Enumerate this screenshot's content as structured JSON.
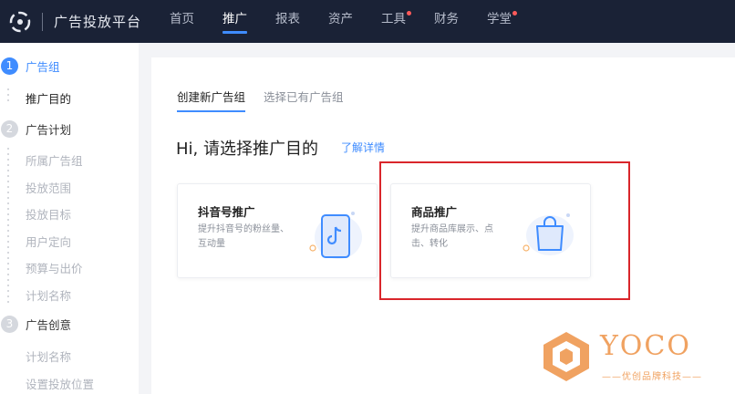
{
  "header": {
    "brand": "广告投放平台",
    "nav": [
      {
        "label": "首页",
        "active": false,
        "dot": false
      },
      {
        "label": "推广",
        "active": true,
        "dot": false
      },
      {
        "label": "报表",
        "active": false,
        "dot": false
      },
      {
        "label": "资产",
        "active": false,
        "dot": false
      },
      {
        "label": "工具",
        "active": false,
        "dot": true
      },
      {
        "label": "财务",
        "active": false,
        "dot": false
      },
      {
        "label": "学堂",
        "active": false,
        "dot": true
      }
    ]
  },
  "sidebar": {
    "steps": [
      {
        "num": "1",
        "title": "广告组",
        "active": true,
        "items": [
          {
            "label": "推广目的",
            "active": true
          }
        ]
      },
      {
        "num": "2",
        "title": "广告计划",
        "active": false,
        "items": [
          {
            "label": "所属广告组"
          },
          {
            "label": "投放范围"
          },
          {
            "label": "投放目标"
          },
          {
            "label": "用户定向"
          },
          {
            "label": "预算与出价"
          },
          {
            "label": "计划名称"
          }
        ]
      },
      {
        "num": "3",
        "title": "广告创意",
        "active": false,
        "items": [
          {
            "label": "计划名称"
          },
          {
            "label": "设置投放位置"
          }
        ]
      }
    ]
  },
  "main": {
    "tabs": [
      {
        "label": "创建新广告组",
        "active": true
      },
      {
        "label": "选择已有广告组",
        "active": false
      }
    ],
    "heading": "Hi, 请选择推广目的",
    "learn_more": "了解详情",
    "cards": [
      {
        "title": "抖音号推广",
        "desc": "提升抖音号的粉丝量、互动量",
        "icon": "phone-tiktok-icon"
      },
      {
        "title": "商品推广",
        "desc": "提升商品库展示、点击、转化",
        "icon": "shopping-bag-icon"
      }
    ]
  },
  "watermark": {
    "text": "YOCO",
    "subtext": "——优创品牌科技——"
  },
  "colors": {
    "accent": "#3f8cff",
    "highlight": "#d9262b",
    "nav_bg": "#1a2236",
    "watermark": "#f0a261"
  }
}
